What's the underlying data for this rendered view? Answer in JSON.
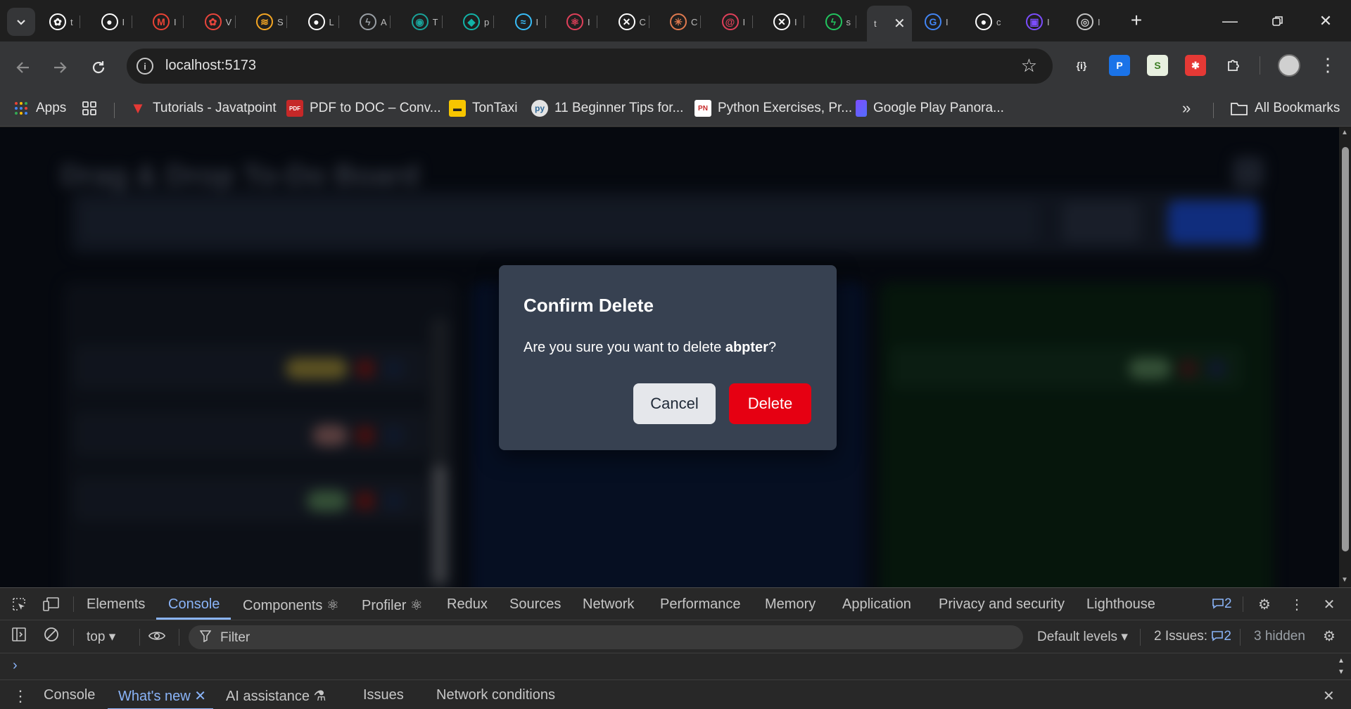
{
  "browser": {
    "tabs": [
      {
        "icon": "openai-icon",
        "fragment": "t",
        "color": "#ffffff"
      },
      {
        "icon": "github-icon",
        "fragment": "I",
        "color": "#ffffff"
      },
      {
        "icon": "gmail-icon",
        "fragment": "I",
        "color": "#ea4335"
      },
      {
        "icon": "openai-red-icon",
        "fragment": "V",
        "color": "#e8453c"
      },
      {
        "icon": "swift-icon",
        "fragment": "S",
        "color": "#f5a623"
      },
      {
        "icon": "github-icon",
        "fragment": "L",
        "color": "#ffffff"
      },
      {
        "icon": "bolt-icon",
        "fragment": "A",
        "color": "#9aa0a6"
      },
      {
        "icon": "globe-icon",
        "fragment": "T",
        "color": "#1aa39a"
      },
      {
        "icon": "diamond-icon",
        "fragment": "p",
        "color": "#12b3a8"
      },
      {
        "icon": "tailwind-icon",
        "fragment": "I",
        "color": "#38bdf8"
      },
      {
        "icon": "react-icon",
        "fragment": "I",
        "color": "#e0405a"
      },
      {
        "icon": "x-circle-icon",
        "fragment": "C",
        "color": "#ffffff"
      },
      {
        "icon": "claude-icon",
        "fragment": "C",
        "color": "#e07a4f"
      },
      {
        "icon": "debian-icon",
        "fragment": "I",
        "color": "#e0405a"
      },
      {
        "icon": "x-circle-icon",
        "fragment": "I",
        "color": "#ffffff"
      },
      {
        "icon": "bolt-green-icon",
        "fragment": "s",
        "color": "#22c55e"
      }
    ],
    "active_tab_fragment": "t",
    "right_tabs": [
      {
        "icon": "google-icon",
        "fragment": "I"
      },
      {
        "icon": "github-icon",
        "fragment": "c"
      },
      {
        "icon": "calendar-icon",
        "fragment": "I"
      },
      {
        "icon": "chrome-icon",
        "fragment": "I"
      }
    ],
    "url": "localhost:5173",
    "bookmarks": [
      {
        "label": "Apps",
        "icon": "apps-grid-icon"
      },
      {
        "label": "Tutorials - Javatpoint",
        "icon": "javatpoint-icon"
      },
      {
        "label": "PDF to DOC – Conv...",
        "icon": "pdf2doc-icon"
      },
      {
        "label": "TonTaxi",
        "icon": "taxi-icon"
      },
      {
        "label": "11 Beginner Tips for...",
        "icon": "python-icon"
      },
      {
        "label": "Python Exercises, Pr...",
        "icon": "pynative-icon"
      },
      {
        "label": "Google Play Panora...",
        "icon": "play-icon"
      }
    ],
    "all_bookmarks_label": "All Bookmarks"
  },
  "page": {
    "background_title": "Drag & Drop To-Do Board"
  },
  "modal": {
    "title": "Confirm Delete",
    "message_prefix": "Are you sure you want to delete ",
    "item_name": "abpter",
    "message_suffix": "?",
    "cancel_label": "Cancel",
    "delete_label": "Delete",
    "delete_color": "#e60012"
  },
  "devtools": {
    "tabs": [
      "Elements",
      "Console",
      "Components ⚛",
      "Profiler ⚛",
      "Redux",
      "Sources",
      "Network",
      "Performance",
      "Memory",
      "Application",
      "Privacy and security",
      "Lighthouse"
    ],
    "active_tab": "Console",
    "issues_badge": "2",
    "context": "top",
    "filter_placeholder": "Filter",
    "levels_label": "Default levels",
    "issues_label": "2 Issues:",
    "issues_count": "2",
    "hidden_label": "3 hidden",
    "drawer_tabs": [
      "Console",
      "What's new",
      "AI assistance",
      "Issues",
      "Network conditions"
    ],
    "drawer_active": "What's new"
  }
}
